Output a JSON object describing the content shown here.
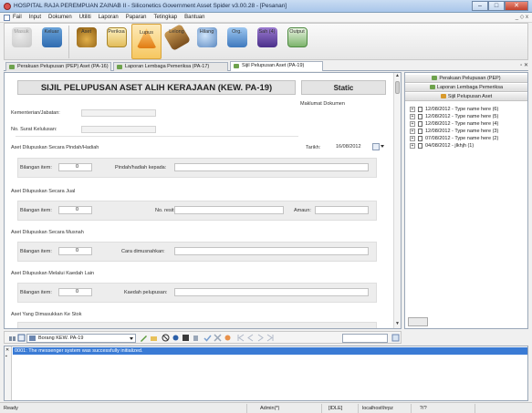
{
  "window": {
    "title": "HOSPITAL RAJA PEREMPUAN ZAINAB II - Siliconetics Government Asset Spider v3.00.28 - [Pesanan]",
    "buttons": {
      "minimize": "–",
      "maximize": "□",
      "close": "✕"
    }
  },
  "menu": {
    "items": [
      "Fail",
      "Input",
      "Dokumen",
      "Utiliti",
      "Laporan",
      "Paparan",
      "Tetingkap",
      "Bantuan"
    ],
    "mdi_controls": "_ ◇ x"
  },
  "toolbar": {
    "buttons": [
      {
        "label": "Masuk",
        "icon": "login-icon",
        "enabled": false
      },
      {
        "label": "Keluar",
        "icon": "lock-icon",
        "enabled": true
      },
      {
        "label": "Aset",
        "icon": "asset-icon",
        "enabled": true
      },
      {
        "label": "Periksa",
        "icon": "clipboard-icon",
        "enabled": true
      },
      {
        "label": "Lupus",
        "icon": "disposal-icon",
        "enabled": true,
        "active": true
      },
      {
        "label": "Lelong",
        "icon": "gavel-icon",
        "enabled": true
      },
      {
        "label": "Hilang",
        "icon": "magnifier-icon",
        "enabled": true
      },
      {
        "label": "Org.",
        "icon": "organization-icon",
        "enabled": true
      },
      {
        "label": "Sah (4)",
        "icon": "approve-icon",
        "enabled": true
      },
      {
        "label": "Output",
        "icon": "output-icon",
        "enabled": true
      }
    ]
  },
  "tabs": [
    {
      "label": "Perakuan Pelupusan (PEP) Aset (PA-16)"
    },
    {
      "label": "Laporan Lembaga Pemeriksa (PA-17)"
    },
    {
      "label": "Sijil Pelupusan Aset (PA-19)"
    }
  ],
  "form": {
    "title": "SIJIL PELUPUSAN ASET ALIH KERAJAAN (KEW. PA-19)",
    "status": "Static",
    "kementerian_label": "Kementerian/Jabatan:",
    "surat_label": "No. Surat Kelulusan:",
    "maklumat_label": "Maklumat Dokumen",
    "tarikh_label": "Tarikh:",
    "tarikh_value": "16/08/2012",
    "sections": [
      {
        "title": "Aset Dilupuskan Secara Pindah/Hadiah",
        "bilangan_label": "Bilangan item:",
        "bilangan_value": "0",
        "field_label": "Pindah/hadiah kepada:"
      },
      {
        "title": "Aset Dilupuskan Secara Jual",
        "bilangan_label": "Bilangan item:",
        "bilangan_value": "0",
        "field_label": "No. resit:",
        "amaun_label": "Amaun:"
      },
      {
        "title": "Aset Dilupuskan Secara Musnah",
        "bilangan_label": "Bilangan item:",
        "bilangan_value": "0",
        "field_label": "Cara dimusnahkan:"
      },
      {
        "title": "Aset Dilupuskan Melalui Kaedah Lain",
        "bilangan_label": "Bilangan item:",
        "bilangan_value": "0",
        "field_label": "Kaedah pelupusan:"
      },
      {
        "title": "Aset Yang Dimasukkan Ke Stok"
      }
    ]
  },
  "navbar": {
    "combo_value": "Borang KEW. PA-19"
  },
  "messages": [
    "0001: The messenger system was successfully initialized."
  ],
  "statusbar": {
    "state": "Ready",
    "user": "Admin(*)",
    "idle": "[IDLE]",
    "server": "localhost\\hrpz",
    "page": "?/?"
  },
  "tree": {
    "headers": [
      "Perakuan Pelupusan (PEP)",
      "Laporan Lembaga Pemeriksa",
      "Sijil Pelupusan Aset"
    ],
    "items": [
      "12/08/2012 - Type name here (6)",
      "12/08/2012 - Type name here (5)",
      "12/08/2012 - Type name here (4)",
      "12/08/2012 - Type name here (3)",
      "07/08/2012 - Type name here (2)",
      "04/08/2012 - jlkhjh (1)"
    ]
  }
}
